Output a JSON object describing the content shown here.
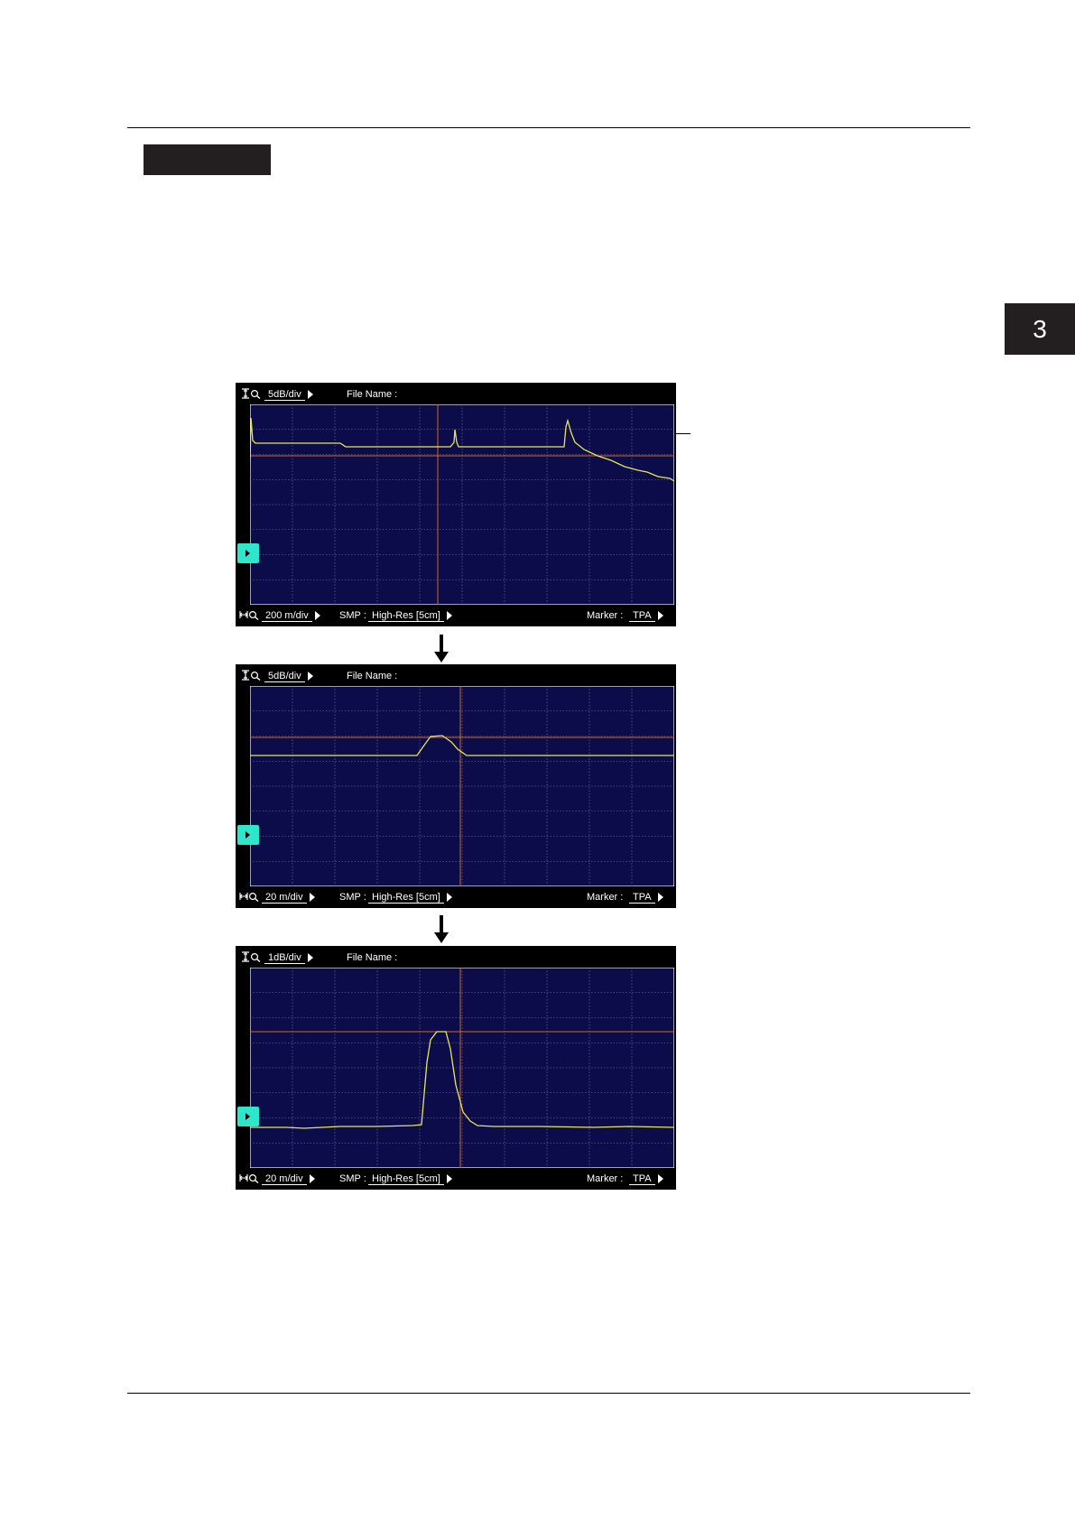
{
  "chapter": {
    "number": "3"
  },
  "screens": [
    {
      "vscale": "5dB/div",
      "file_name_label": "File Name :",
      "hscale": "200 m/div",
      "smp_label": "SMP :",
      "smp_value": "High-Res [5cm]",
      "marker_label": "Marker :",
      "marker_value": "TPA"
    },
    {
      "vscale": "5dB/div",
      "file_name_label": "File Name :",
      "hscale": "20 m/div",
      "smp_label": "SMP :",
      "smp_value": "High-Res [5cm]",
      "marker_label": "Marker :",
      "marker_value": "TPA"
    },
    {
      "vscale": "1dB/div",
      "file_name_label": "File Name :",
      "hscale": "20 m/div",
      "smp_label": "SMP :",
      "smp_value": "High-Res [5cm]",
      "marker_label": "Marker :",
      "marker_value": "TPA"
    }
  ],
  "colors": {
    "screen_background": "#000000",
    "plot_background": "#0c0c4a",
    "grid": "#7a7aa8",
    "trace": "#e6e65a",
    "cursor": "#d2691e",
    "cursor_tab": "#2ee6c9",
    "tab_background": "#231f20"
  },
  "traces": [
    [
      [
        0,
        68
      ],
      [
        1,
        15
      ],
      [
        3,
        40
      ],
      [
        6,
        43
      ],
      [
        100,
        43
      ],
      [
        106,
        47
      ],
      [
        222,
        47
      ],
      [
        226,
        42
      ],
      [
        227,
        28
      ],
      [
        229,
        42
      ],
      [
        231,
        47
      ],
      [
        348,
        47
      ],
      [
        350,
        25
      ],
      [
        352,
        18
      ],
      [
        356,
        32
      ],
      [
        360,
        42
      ],
      [
        370,
        50
      ],
      [
        385,
        57
      ],
      [
        400,
        62
      ],
      [
        415,
        69
      ],
      [
        430,
        73
      ],
      [
        440,
        75
      ],
      [
        452,
        80
      ],
      [
        465,
        82
      ],
      [
        470,
        85
      ]
    ],
    [
      [
        0,
        77
      ],
      [
        80,
        77
      ],
      [
        160,
        77
      ],
      [
        185,
        77
      ],
      [
        192,
        67
      ],
      [
        200,
        56
      ],
      [
        213,
        55
      ],
      [
        223,
        62
      ],
      [
        230,
        70
      ],
      [
        240,
        77
      ],
      [
        300,
        77
      ],
      [
        380,
        77
      ],
      [
        430,
        77
      ],
      [
        470,
        77
      ]
    ],
    [
      [
        0,
        177
      ],
      [
        40,
        177
      ],
      [
        60,
        178
      ],
      [
        100,
        176
      ],
      [
        140,
        176
      ],
      [
        180,
        175
      ],
      [
        190,
        174
      ],
      [
        196,
        105
      ],
      [
        200,
        80
      ],
      [
        207,
        71
      ],
      [
        217,
        71
      ],
      [
        222,
        90
      ],
      [
        228,
        130
      ],
      [
        236,
        160
      ],
      [
        244,
        170
      ],
      [
        252,
        175
      ],
      [
        270,
        176
      ],
      [
        320,
        176
      ],
      [
        380,
        177
      ],
      [
        420,
        176
      ],
      [
        470,
        177
      ]
    ]
  ]
}
